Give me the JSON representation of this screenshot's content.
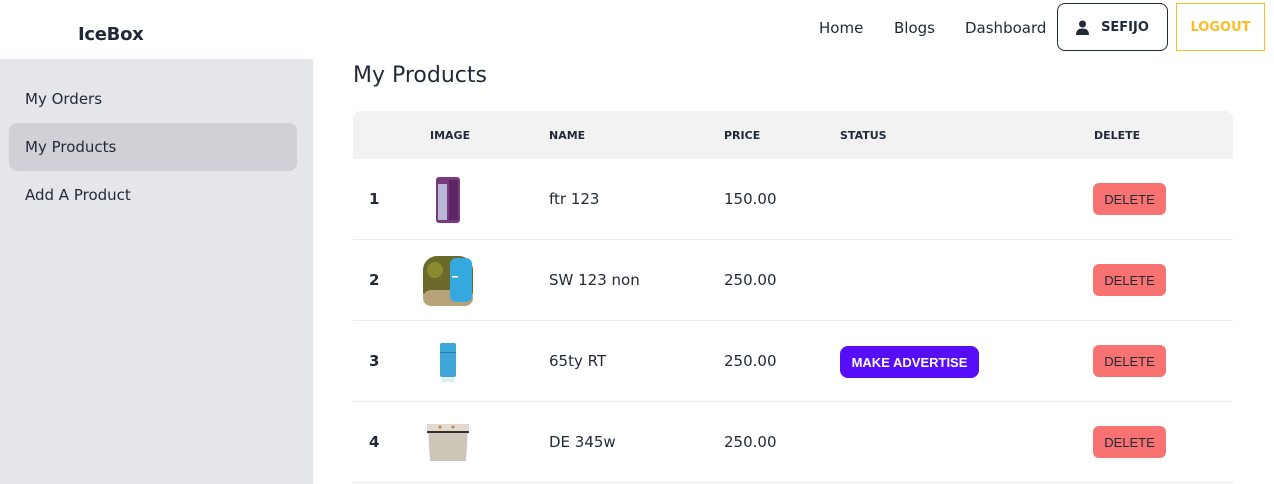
{
  "header": {
    "brand": "IceBox",
    "nav": [
      "Home",
      "Blogs",
      "Dashboard"
    ],
    "user": "SEFIJO",
    "logout": "LOGOUT"
  },
  "sidebar": {
    "items": [
      {
        "label": "My Orders",
        "active": false
      },
      {
        "label": "My Products",
        "active": true
      },
      {
        "label": "Add A Product",
        "active": false
      }
    ]
  },
  "main": {
    "title": "My Products",
    "columns": [
      "IMAGE",
      "NAME",
      "PRICE",
      "STATUS",
      "DELETE"
    ],
    "rows": [
      {
        "num": "1",
        "image": "purple-fridge",
        "name": "ftr 123",
        "price": "150.00",
        "status": "",
        "delete": "DELETE"
      },
      {
        "num": "2",
        "image": "blue-retro-fridge-outdoor",
        "name": "SW 123 non",
        "price": "250.00",
        "status": "",
        "delete": "DELETE"
      },
      {
        "num": "3",
        "image": "blue-fridge",
        "name": "65ty RT",
        "price": "250.00",
        "status": "MAKE ADVERTISE",
        "delete": "DELETE"
      },
      {
        "num": "4",
        "image": "chest-freezer",
        "name": "DE 345w",
        "price": "250.00",
        "status": "",
        "delete": "DELETE"
      }
    ]
  },
  "colors": {
    "sidebar_bg": "#e5e6ea",
    "active_item": "#d0d1d6",
    "primary": "#570df8",
    "error": "#f87272",
    "warning": "#fbbd23"
  }
}
